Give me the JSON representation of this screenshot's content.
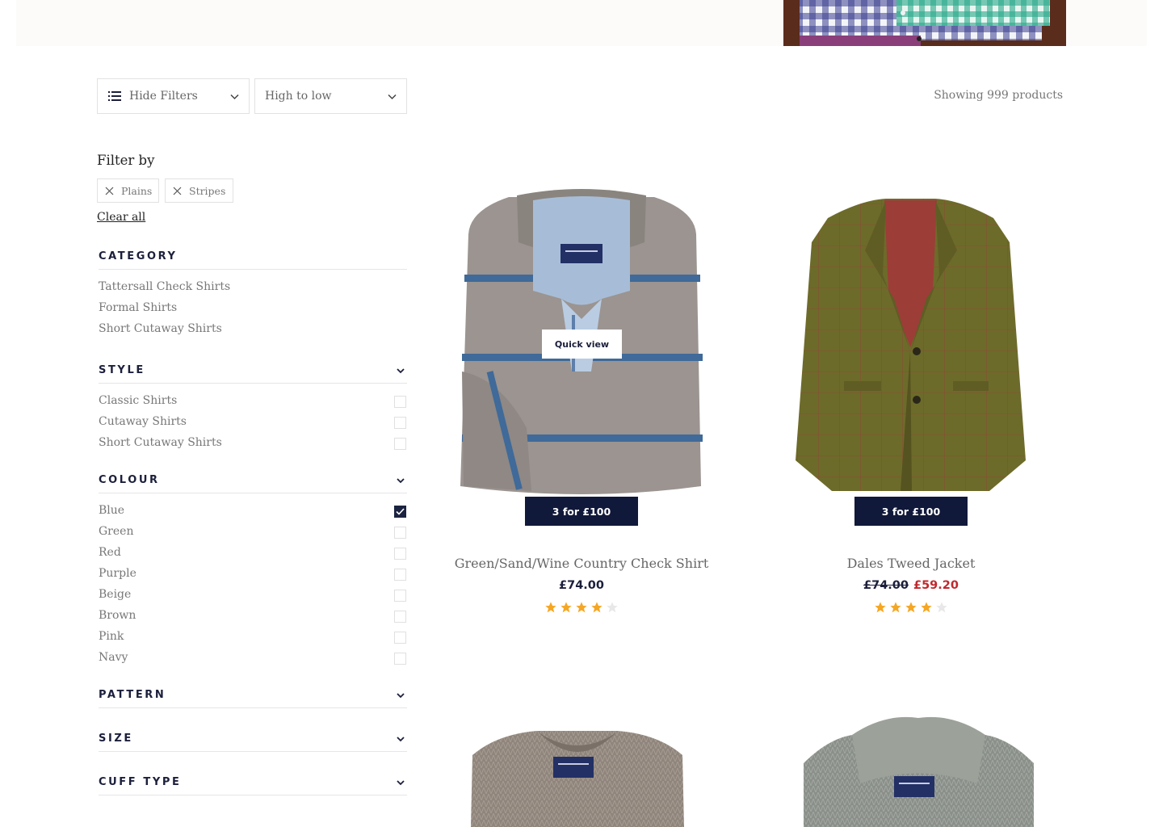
{
  "toolbar": {
    "filter_toggle_label": "Hide Filters",
    "sort_label": "High to low",
    "showing_text": "Showing 999 products"
  },
  "filters": {
    "heading": "Filter by",
    "active_chips": [
      "Plains",
      "Stripes"
    ],
    "clear_all_label": "Clear all",
    "sections": {
      "category": {
        "title": "CATEGORY",
        "items": [
          "Tattersall Check Shirts",
          "Formal Shirts",
          "Short Cutaway Shirts"
        ]
      },
      "style": {
        "title": "STYLE",
        "items": [
          "Classic Shirts",
          "Cutaway Shirts",
          "Short Cutaway Shirts"
        ]
      },
      "colour": {
        "title": "COLOUR",
        "items": [
          "Blue",
          "Green",
          "Red",
          "Purple",
          "Beige",
          "Brown",
          "Pink",
          "Navy"
        ],
        "checked": [
          "Blue"
        ]
      },
      "pattern": {
        "title": "PATTERN"
      },
      "size": {
        "title": "SIZE"
      },
      "cuff_type": {
        "title": "CUFF TYPE"
      }
    }
  },
  "products": [
    {
      "name": "Green/Sand/Wine Country Check Shirt",
      "price": "£74.00",
      "promo": "3 for £100",
      "rating": 4,
      "rating_max": 5,
      "quick_view_label": "Quick view"
    },
    {
      "name": "Dales Tweed Jacket",
      "was_price": "£74.00",
      "price": "£59.20",
      "promo": "3 for £100",
      "rating": 4,
      "rating_max": 5
    }
  ],
  "colors": {
    "navy": "#11193a",
    "sale_red": "#c0282d",
    "star_gold": "#f5a623",
    "star_empty": "#e8e8e8"
  },
  "icons": {
    "filter_toggle": "list-icon",
    "sort": "chevron-down-icon",
    "chip_remove": "close-icon",
    "checkbox_checked": "check-icon",
    "rating": "star-icon"
  }
}
